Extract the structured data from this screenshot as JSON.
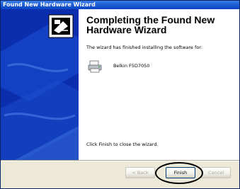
{
  "window": {
    "title": "Found New Hardware Wizard"
  },
  "content": {
    "heading": "Completing the Found New Hardware Wizard",
    "intro": "The wizard has finished installing the software for:",
    "device_name": "Belkin F5D7050",
    "finish_hint": "Click Finish to close the wizard."
  },
  "buttons": {
    "back": "< Back",
    "finish": "Finish",
    "cancel": "Cancel"
  },
  "colors": {
    "titlebar": "#0B45C4",
    "side_panel": "#0A2EAE",
    "dialog_bg": "#ECE9D8"
  },
  "icons": {
    "wizard_graphic": "hardware-wizard-icon",
    "device": "printer-device-icon"
  }
}
